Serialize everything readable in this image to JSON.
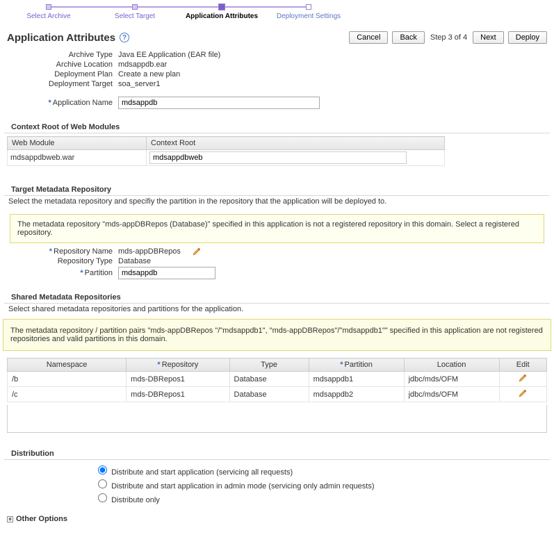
{
  "wizard": {
    "steps": [
      "Select Archive",
      "Select Target",
      "Application Attributes",
      "Deployment Settings"
    ]
  },
  "page_title": "Application Attributes",
  "nav": {
    "cancel": "Cancel",
    "back": "Back",
    "step_indicator": "Step 3 of 4",
    "next": "Next",
    "deploy": "Deploy"
  },
  "attrs": {
    "archive_type_label": "Archive Type",
    "archive_type_value": "Java EE Application (EAR file)",
    "archive_location_label": "Archive Location",
    "archive_location_value": "mdsappdb.ear",
    "deployment_plan_label": "Deployment Plan",
    "deployment_plan_value": "Create a new plan",
    "deployment_target_label": "Deployment Target",
    "deployment_target_value": "soa_server1",
    "app_name_label": "Application Name",
    "app_name_value": "mdsappdb"
  },
  "context_root": {
    "title": "Context Root of Web Modules",
    "headers": [
      "Web Module",
      "Context Root"
    ],
    "row": {
      "module": "mdsappdbweb.war",
      "root": "mdsappdbweb"
    }
  },
  "target_repo": {
    "title": "Target Metadata Repository",
    "desc": "Select the metadata repository and specifiy the partition in the repository that the application will be deployed to.",
    "warning": "The metadata repository \"mds-appDBRepos (Database)\" specified in this application is not a registered repository in this domain. Select a registered repository.",
    "repo_name_label": "Repository Name",
    "repo_name_value": "mds-appDBRepos",
    "repo_type_label": "Repository Type",
    "repo_type_value": "Database",
    "partition_label": "Partition",
    "partition_value": "mdsappdb"
  },
  "shared_repos": {
    "title": "Shared Metadata Repositories",
    "desc": "Select shared metadata repositories and partitions for the application.",
    "warning": "The metadata repository / partition pairs \"mds-appDBRepos \"/\"mdsappdb1\", \"mds-appDBRepos\"/\"mdsappdb1\"\" specified in this application are not registered repositories and valid partitions in this domain.",
    "headers": {
      "namespace": "Namespace",
      "repository": "Repository",
      "type": "Type",
      "partition": "Partition",
      "location": "Location",
      "edit": "Edit"
    },
    "rows": [
      {
        "ns": "/b",
        "repo": "mds-DBRepos1",
        "type": "Database",
        "partition": "mdsappdb1",
        "location": "jdbc/mds/OFM"
      },
      {
        "ns": "/c",
        "repo": "mds-DBRepos1",
        "type": "Database",
        "partition": "mdsappdb2",
        "location": "jdbc/mds/OFM"
      }
    ]
  },
  "distribution": {
    "title": "Distribution",
    "opts": [
      "Distribute and start application (servicing all requests)",
      "Distribute and start application in admin mode (servicing only admin requests)",
      "Distribute only"
    ]
  },
  "other_options": "Other Options",
  "star": "*"
}
